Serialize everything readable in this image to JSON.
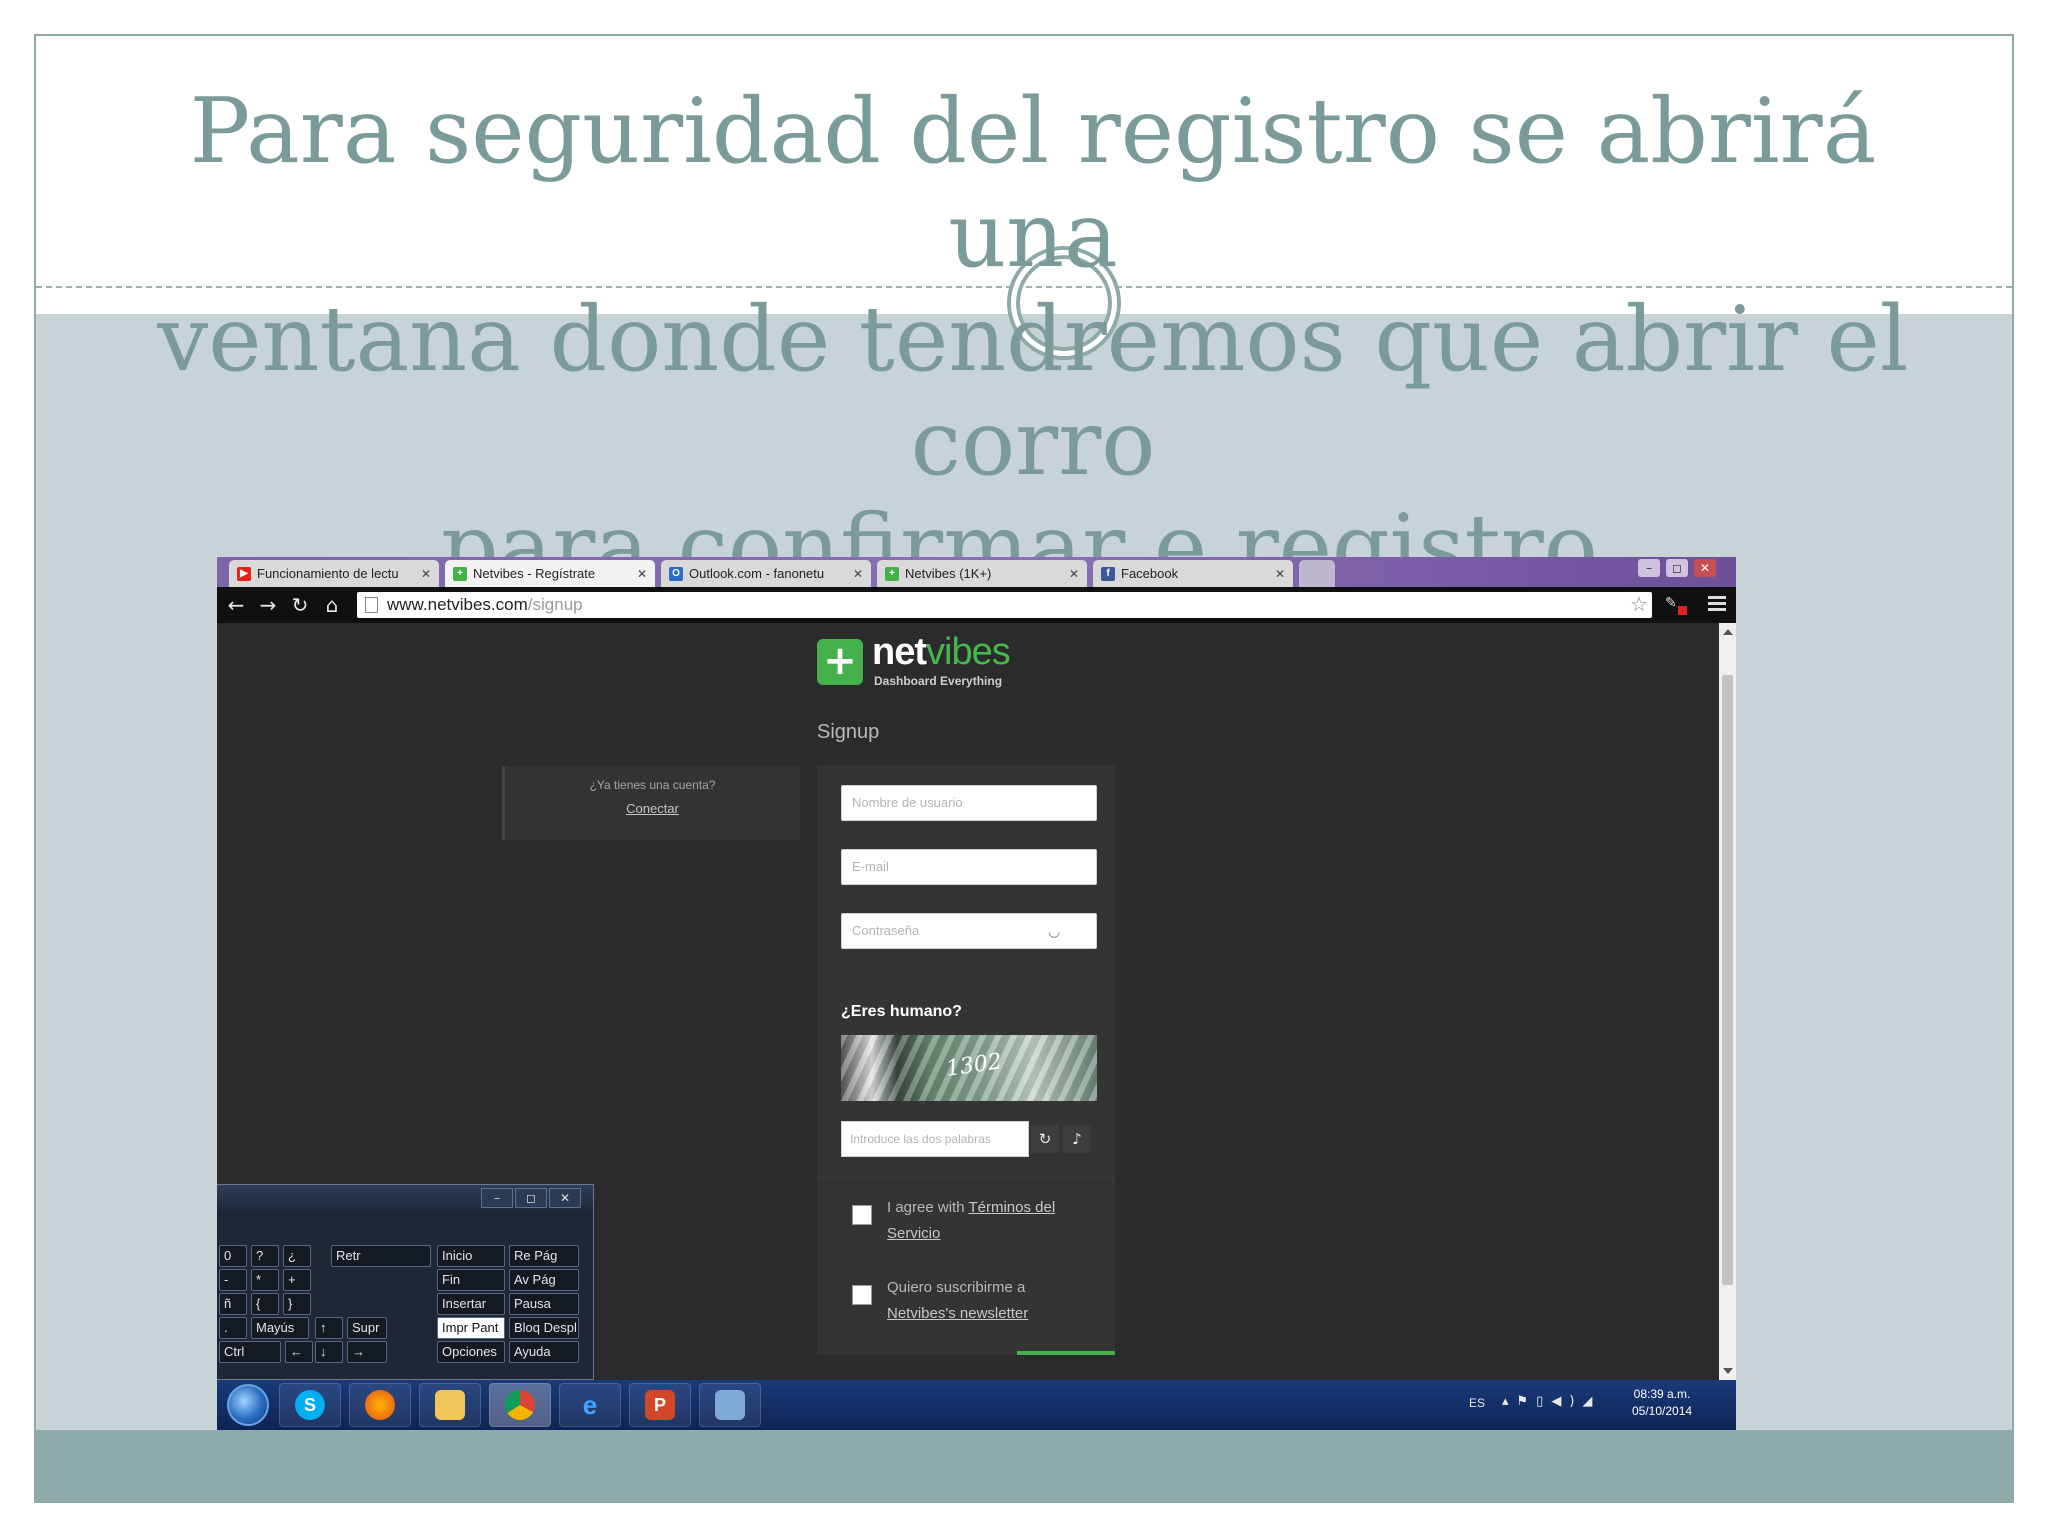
{
  "slide": {
    "title_line1": "Para seguridad del registro se abrirá una",
    "title_line2": "ventana donde tendremos que abrir el corro",
    "title_line3": "para confirmar e registro."
  },
  "browser": {
    "tabs": [
      {
        "label": "Funcionamiento de lectu",
        "favicon": "youtube-icon",
        "color": "#e62117",
        "active": false
      },
      {
        "label": "Netvibes - Regístrate",
        "favicon": "netvibes-icon",
        "color": "#44b14a",
        "active": true
      },
      {
        "label": "Outlook.com - fanonetu",
        "favicon": "outlook-icon",
        "color": "#2b6cc4",
        "active": false
      },
      {
        "label": "Netvibes (1K+)",
        "favicon": "netvibes-icon",
        "color": "#44b14a",
        "active": false
      },
      {
        "label": "Facebook",
        "favicon": "facebook-icon",
        "color": "#3b5998",
        "active": false
      }
    ],
    "url_host": "www.netvibes.com",
    "url_path": "/signup"
  },
  "page": {
    "logo_net": "net",
    "logo_vibes": "vibes",
    "tagline": "Dashboard Everything",
    "signup_heading": "Signup",
    "account_question": "¿Ya tienes una cuenta?",
    "account_link": "Conectar",
    "username_placeholder": "Nombre de usuario",
    "email_placeholder": "E-mail",
    "password_placeholder": "Contraseña",
    "human_label": "¿Eres humano?",
    "captcha_text": "1302",
    "captcha_placeholder": "Introduce las dos palabras",
    "terms_prefix": "I agree with ",
    "terms_link": "Términos del Servicio",
    "newsletter_prefix": "Quiero suscribirme a ",
    "newsletter_link": "Netvibes's newsletter"
  },
  "keyboard": {
    "keys": [
      "0",
      "?",
      "¿",
      "Retr",
      "Inicio",
      "Re Pág",
      "-",
      "*",
      "+",
      "Fin",
      "Av Pág",
      "ñ",
      "{",
      "}",
      "Insertar",
      "Pausa",
      ".",
      "Mayús",
      "↑",
      "Supr",
      "Impr Pant",
      "Bloq Despl",
      "Ctrl",
      "←",
      "↓",
      "→",
      "Opciones",
      "Ayuda"
    ]
  },
  "taskbar": {
    "apps": [
      "skype-icon",
      "firefox-icon",
      "file-explorer-icon",
      "chrome-icon",
      "internet-explorer-icon",
      "powerpoint-icon",
      "network-icon"
    ],
    "lang": "ES",
    "time": "08:39 a.m.",
    "date": "05/10/2014"
  }
}
